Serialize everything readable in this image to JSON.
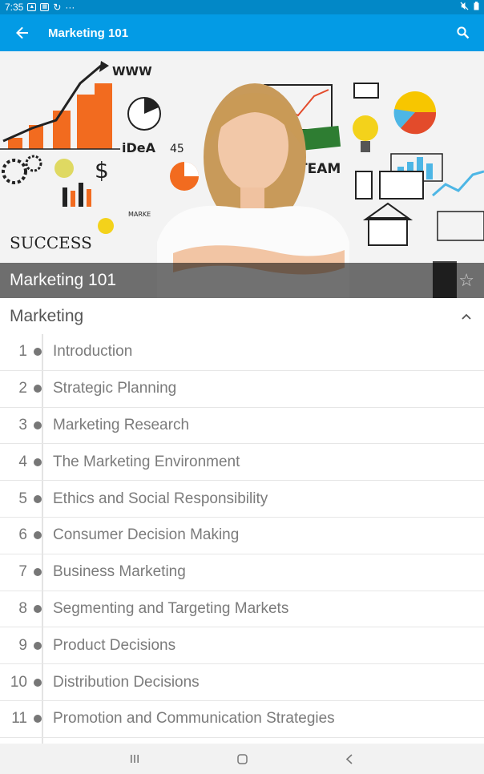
{
  "status_bar": {
    "time": "7:35",
    "dots": "···"
  },
  "app_bar": {
    "title": "Marketing 101"
  },
  "hero": {
    "caption": "Marketing 101",
    "art_words": [
      "WWW",
      "iDeA",
      "45",
      "TEAM",
      "SUCCESS",
      "MARKE",
      "$"
    ]
  },
  "section": {
    "label": "Marketing"
  },
  "items": [
    {
      "num": "1",
      "title": "Introduction"
    },
    {
      "num": "2",
      "title": "Strategic Planning"
    },
    {
      "num": "3",
      "title": "Marketing Research"
    },
    {
      "num": "4",
      "title": "The Marketing Environment"
    },
    {
      "num": "5",
      "title": "Ethics and Social Responsibility"
    },
    {
      "num": "6",
      "title": "Consumer Decision Making"
    },
    {
      "num": "7",
      "title": "Business Marketing"
    },
    {
      "num": "8",
      "title": "Segmenting and Targeting Markets"
    },
    {
      "num": "9",
      "title": "Product Decisions"
    },
    {
      "num": "10",
      "title": "Distribution Decisions"
    },
    {
      "num": "11",
      "title": "Promotion and Communication Strategies"
    }
  ],
  "colors": {
    "status_bar": "#0288c7",
    "app_bar": "#039be5",
    "text_muted": "#7b7b7b"
  }
}
